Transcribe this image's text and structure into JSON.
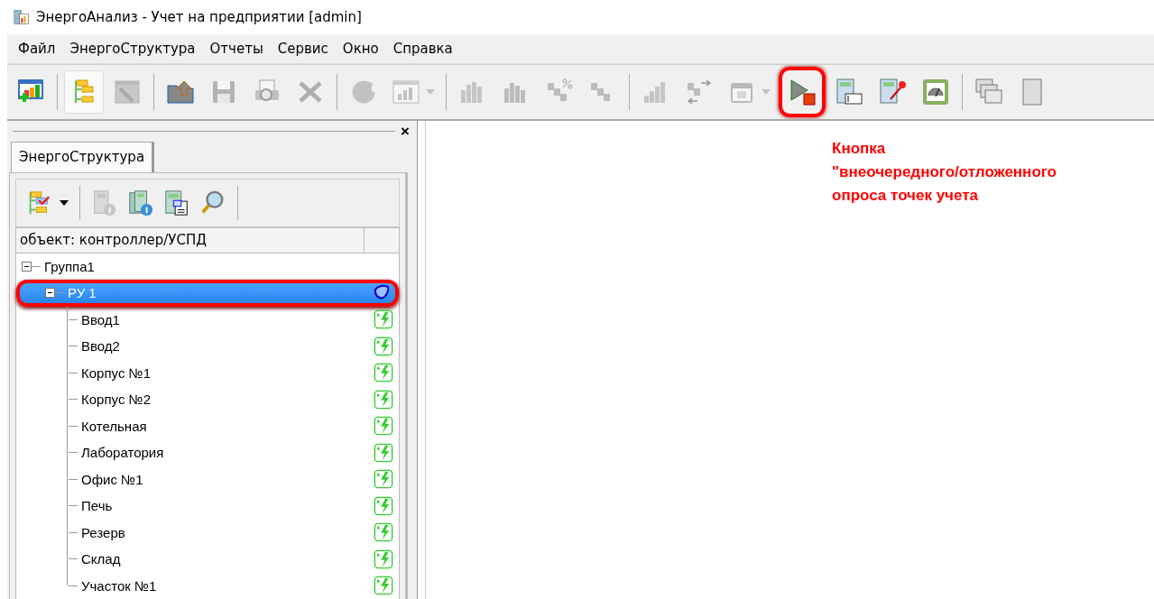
{
  "window": {
    "title": "ЭнергоАнализ - Учет на предприятии [admin]"
  },
  "menu": [
    {
      "label": "Файл"
    },
    {
      "label": "ЭнергоСтруктура"
    },
    {
      "label": "Отчеты"
    },
    {
      "label": "Сервис"
    },
    {
      "label": "Окно"
    },
    {
      "label": "Справка"
    }
  ],
  "toolbar": [
    {
      "kind": "button",
      "disabled": false,
      "pressed": false,
      "highlighted": false
    },
    {
      "kind": "separator"
    },
    {
      "kind": "button",
      "disabled": false,
      "pressed": true,
      "highlighted": false
    },
    {
      "kind": "button",
      "disabled": true,
      "pressed": false,
      "highlighted": false
    },
    {
      "kind": "separator"
    },
    {
      "kind": "button",
      "disabled": false,
      "pressed": false,
      "highlighted": false
    },
    {
      "kind": "button",
      "disabled": true,
      "pressed": false,
      "highlighted": false
    },
    {
      "kind": "button",
      "disabled": true,
      "pressed": false,
      "highlighted": false
    },
    {
      "kind": "button",
      "disabled": true,
      "pressed": false,
      "highlighted": false
    },
    {
      "kind": "separator"
    },
    {
      "kind": "button",
      "disabled": true,
      "pressed": false,
      "highlighted": false
    },
    {
      "kind": "dropdown",
      "disabled": true,
      "pressed": false,
      "highlighted": false
    },
    {
      "kind": "separator"
    },
    {
      "kind": "button",
      "disabled": true,
      "pressed": false,
      "highlighted": false
    },
    {
      "kind": "button",
      "disabled": true,
      "pressed": false,
      "highlighted": false
    },
    {
      "kind": "button",
      "disabled": true,
      "pressed": false,
      "highlighted": false
    },
    {
      "kind": "button",
      "disabled": true,
      "pressed": false,
      "highlighted": false
    },
    {
      "kind": "separator"
    },
    {
      "kind": "button",
      "disabled": true,
      "pressed": false,
      "highlighted": false
    },
    {
      "kind": "button",
      "disabled": true,
      "pressed": false,
      "highlighted": false
    },
    {
      "kind": "dropdown",
      "disabled": true,
      "pressed": false,
      "highlighted": false
    },
    {
      "kind": "button",
      "disabled": false,
      "pressed": false,
      "highlighted": true
    },
    {
      "kind": "button",
      "disabled": false,
      "pressed": false,
      "highlighted": false
    },
    {
      "kind": "button",
      "disabled": false,
      "pressed": false,
      "highlighted": false
    },
    {
      "kind": "button",
      "disabled": false,
      "pressed": false,
      "highlighted": false
    },
    {
      "kind": "separator"
    },
    {
      "kind": "button",
      "disabled": false,
      "pressed": false,
      "highlighted": false
    },
    {
      "kind": "button",
      "disabled": false,
      "pressed": false,
      "highlighted": false
    }
  ],
  "panel": {
    "close": "×",
    "tabs": [
      {
        "label": "ЭнергоСтруктура",
        "selected": true
      }
    ],
    "toolbar": [
      {
        "kind": "dropdown",
        "disabled": false
      },
      {
        "kind": "separator"
      },
      {
        "kind": "button",
        "disabled": true
      },
      {
        "kind": "button",
        "disabled": false
      },
      {
        "kind": "button",
        "disabled": false
      },
      {
        "kind": "button",
        "disabled": false
      },
      {
        "kind": "separator"
      }
    ],
    "columns": [
      {
        "label": "объект: контроллер/УСПД"
      }
    ],
    "tree": [
      {
        "label": "Группа1",
        "expanded": true,
        "selected": false,
        "highlighted": false,
        "children": [
          {
            "label": "РУ 1",
            "kind": "controller",
            "expanded": true,
            "selected": true,
            "highlighted": true,
            "children": [
              {
                "label": "Ввод1",
                "kind": "meter",
                "selected": false,
                "highlighted": false
              },
              {
                "label": "Ввод2",
                "kind": "meter",
                "selected": false,
                "highlighted": false
              },
              {
                "label": "Корпус №1",
                "kind": "meter",
                "selected": false,
                "highlighted": false
              },
              {
                "label": "Корпус №2",
                "kind": "meter",
                "selected": false,
                "highlighted": false
              },
              {
                "label": "Котельная",
                "kind": "meter",
                "selected": false,
                "highlighted": false
              },
              {
                "label": "Лаборатория",
                "kind": "meter",
                "selected": false,
                "highlighted": false
              },
              {
                "label": "Офис №1",
                "kind": "meter",
                "selected": false,
                "highlighted": false
              },
              {
                "label": "Печь",
                "kind": "meter",
                "selected": false,
                "highlighted": false
              },
              {
                "label": "Резерв",
                "kind": "meter",
                "selected": false,
                "highlighted": false
              },
              {
                "label": "Склад",
                "kind": "meter",
                "selected": false,
                "highlighted": false
              },
              {
                "label": "Участок №1",
                "kind": "meter",
                "selected": false,
                "highlighted": false
              }
            ]
          }
        ]
      }
    ]
  },
  "callout": {
    "text": "Кнопка\n\"внеочередного/отложенного\nопроса точек учета"
  }
}
